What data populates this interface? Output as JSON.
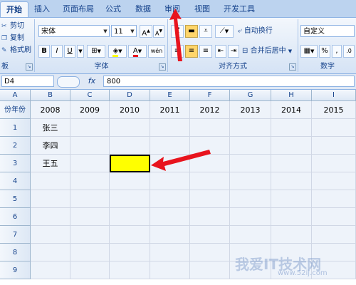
{
  "tabs": [
    "开始",
    "插入",
    "页面布局",
    "公式",
    "数据",
    "审阅",
    "视图",
    "开发工具"
  ],
  "ribbon": {
    "clipboard": {
      "cut": "剪切",
      "copy": "复制",
      "format_painter": "格式刷",
      "title": "板"
    },
    "font": {
      "name": "宋体",
      "size": "11",
      "grow": "A",
      "shrink": "A",
      "bold": "B",
      "italic": "I",
      "underline": "U",
      "fill_color_letter": "A",
      "phonetic": "wén",
      "title": "字体"
    },
    "alignment": {
      "wrap_text": "自动换行",
      "merge_center": "合并后居中",
      "title": "对齐方式"
    },
    "number": {
      "format": "自定义",
      "percent": "%",
      "comma": ",",
      "title": "数字"
    }
  },
  "formula_bar": {
    "name_box": "D4",
    "fx": "fx",
    "value": "800"
  },
  "columns": [
    "A",
    "B",
    "C",
    "D",
    "E",
    "F",
    "G",
    "H",
    "I"
  ],
  "rows": [
    "1",
    "2",
    "3",
    "4",
    "5",
    "6",
    "7",
    "8",
    "9"
  ],
  "cells": [
    [
      "份年份",
      "2008",
      "2009",
      "2010",
      "2011",
      "2012",
      "2013",
      "2014",
      "2015"
    ],
    [
      "1",
      "张三",
      "",
      "",
      "",
      "",
      "",
      "",
      ""
    ],
    [
      "2",
      "李四",
      "",
      "",
      "",
      "",
      "",
      "",
      ""
    ],
    [
      "3",
      "王五",
      "",
      "",
      "",
      "",
      "",
      "",
      ""
    ],
    [
      "4",
      "",
      "",
      "",
      "",
      "",
      "",
      "",
      ""
    ],
    [
      "5",
      "",
      "",
      "",
      "",
      "",
      "",
      "",
      ""
    ],
    [
      "6",
      "",
      "",
      "",
      "",
      "",
      "",
      "",
      ""
    ],
    [
      "7",
      "",
      "",
      "",
      "",
      "",
      "",
      "",
      ""
    ],
    [
      "8",
      "",
      "",
      "",
      "",
      "",
      "",
      "",
      ""
    ],
    [
      "9",
      "",
      "",
      "",
      "",
      "",
      "",
      "",
      ""
    ]
  ],
  "highlight": {
    "color": "#ffff00",
    "arrow_color": "#e8141e"
  },
  "watermark": {
    "main": "我爱IT技术网",
    "sub": "www.52ij.com"
  }
}
